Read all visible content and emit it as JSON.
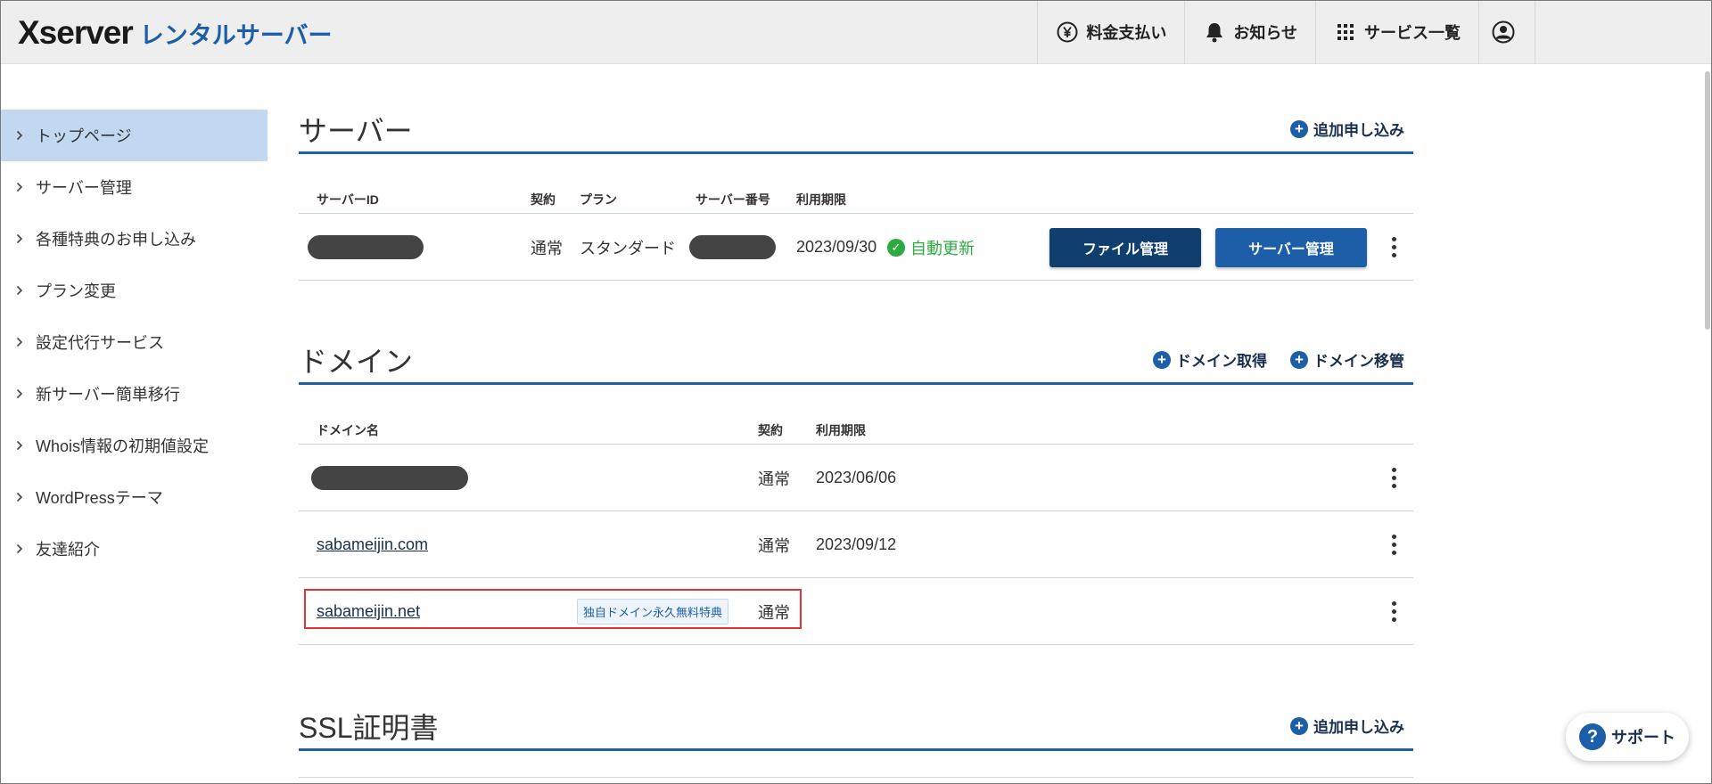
{
  "header": {
    "logo_main": "Xserver",
    "logo_sub": "レンタルサーバー",
    "nav": [
      {
        "label": "料金支払い",
        "icon": "yen-icon"
      },
      {
        "label": "お知らせ",
        "icon": "bell-icon"
      },
      {
        "label": "サービス一覧",
        "icon": "grid-icon"
      }
    ],
    "user_icon": "user-icon"
  },
  "sidebar": {
    "items": [
      {
        "label": "トップページ"
      },
      {
        "label": "サーバー管理"
      },
      {
        "label": "各種特典のお申し込み"
      },
      {
        "label": "プラン変更"
      },
      {
        "label": "設定代行サービス"
      },
      {
        "label": "新サーバー簡単移行"
      },
      {
        "label": "Whois情報の初期値設定"
      },
      {
        "label": "WordPressテーマ"
      },
      {
        "label": "友達紹介"
      }
    ]
  },
  "server": {
    "title": "サーバー",
    "add_label": "追加申し込み",
    "headers": {
      "id": "サーバーID",
      "contract": "契約",
      "plan": "プラン",
      "number": "サーバー番号",
      "expiry": "利用期限"
    },
    "rows": [
      {
        "contract": "通常",
        "plan": "スタンダード",
        "expiry": "2023/09/30",
        "status": "自動更新",
        "file_btn": "ファイル管理",
        "server_btn": "サーバー管理"
      }
    ]
  },
  "domain": {
    "title": "ドメイン",
    "acquire_label": "ドメイン取得",
    "transfer_label": "ドメイン移管",
    "headers": {
      "name": "ドメイン名",
      "contract": "契約",
      "expiry": "利用期限"
    },
    "rows": [
      {
        "name": "",
        "contract": "通常",
        "expiry": "2023/06/06"
      },
      {
        "name": "sabameijin.com",
        "contract": "通常",
        "expiry": "2023/09/12"
      },
      {
        "name": "sabameijin.net",
        "badge": "独自ドメイン永久無料特典",
        "contract": "通常",
        "expiry": ""
      }
    ]
  },
  "ssl": {
    "title": "SSL証明書",
    "add_label": "追加申し込み"
  },
  "support": {
    "label": "サポート",
    "icon": "question-icon"
  },
  "colors": {
    "accent": "#1c5fa8",
    "dark_button": "#103e6e",
    "active_nav": "#c1d8f0",
    "success": "#2daa42",
    "highlight": "#e53232"
  }
}
